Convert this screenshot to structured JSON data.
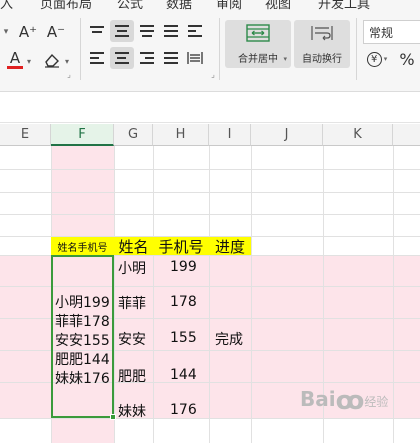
{
  "ribbon": {
    "tabs": [
      "入",
      "页面布局",
      "公式",
      "数据",
      "审阅",
      "视图",
      "开发工具"
    ],
    "font_grow": "A⁺",
    "font_shrink": "A⁻",
    "font_color": "A",
    "font_color_hex": "#e02020",
    "merge_center_label": "合并居中",
    "wrap_text_label": "自动换行",
    "number_format": "常规",
    "percent": "%",
    "currency_icon": "¥"
  },
  "sheet": {
    "columns": [
      "E",
      "F",
      "G",
      "H",
      "I",
      "J",
      "K"
    ],
    "active_column": "F",
    "headers": {
      "merged": "姓名手机号",
      "name": "姓名",
      "phone": "手机号",
      "progress": "进度"
    },
    "merged_lines": [
      "小明199",
      "菲菲178",
      "安安155",
      "肥肥144",
      "妹妹176"
    ],
    "names": [
      "小明",
      "菲菲",
      "安安",
      "肥肥",
      "妹妹"
    ],
    "phones": [
      "199",
      "178",
      "155",
      "144",
      "176"
    ],
    "progress_value": "完成",
    "highlight_hex": "#ffff00"
  },
  "watermark": {
    "brand": "Bai",
    "suffix": "经验"
  }
}
